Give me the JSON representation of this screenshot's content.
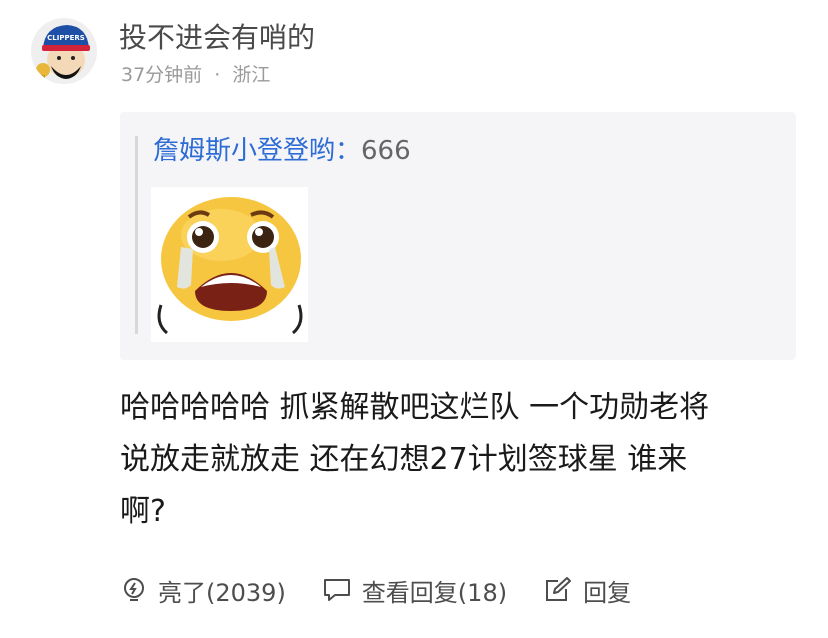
{
  "post": {
    "username": "投不进会有哨的",
    "time": "37分钟前",
    "separator": "·",
    "location": "浙江"
  },
  "quote": {
    "author": "詹姆斯小登登哟：",
    "text": "666"
  },
  "comment": {
    "line1": "哈哈哈哈哈 抓紧解散吧这烂队 一个功勋老将",
    "line2": "说放走就放走 还在幻想27计划签球星 谁来",
    "line3": "啊?"
  },
  "actions": {
    "like_label": "亮了(2039)",
    "view_replies_label": "查看回复(18)",
    "reply_label": "回复"
  },
  "colors": {
    "author_blue": "#2d6bd6",
    "quote_bg": "#f5f5f7",
    "meta_gray": "#9a9a9a"
  },
  "icons": [
    "avatar-clippers",
    "crying-emoji-sticker",
    "lightbulb-icon",
    "comment-bubble-icon",
    "edit-icon"
  ]
}
